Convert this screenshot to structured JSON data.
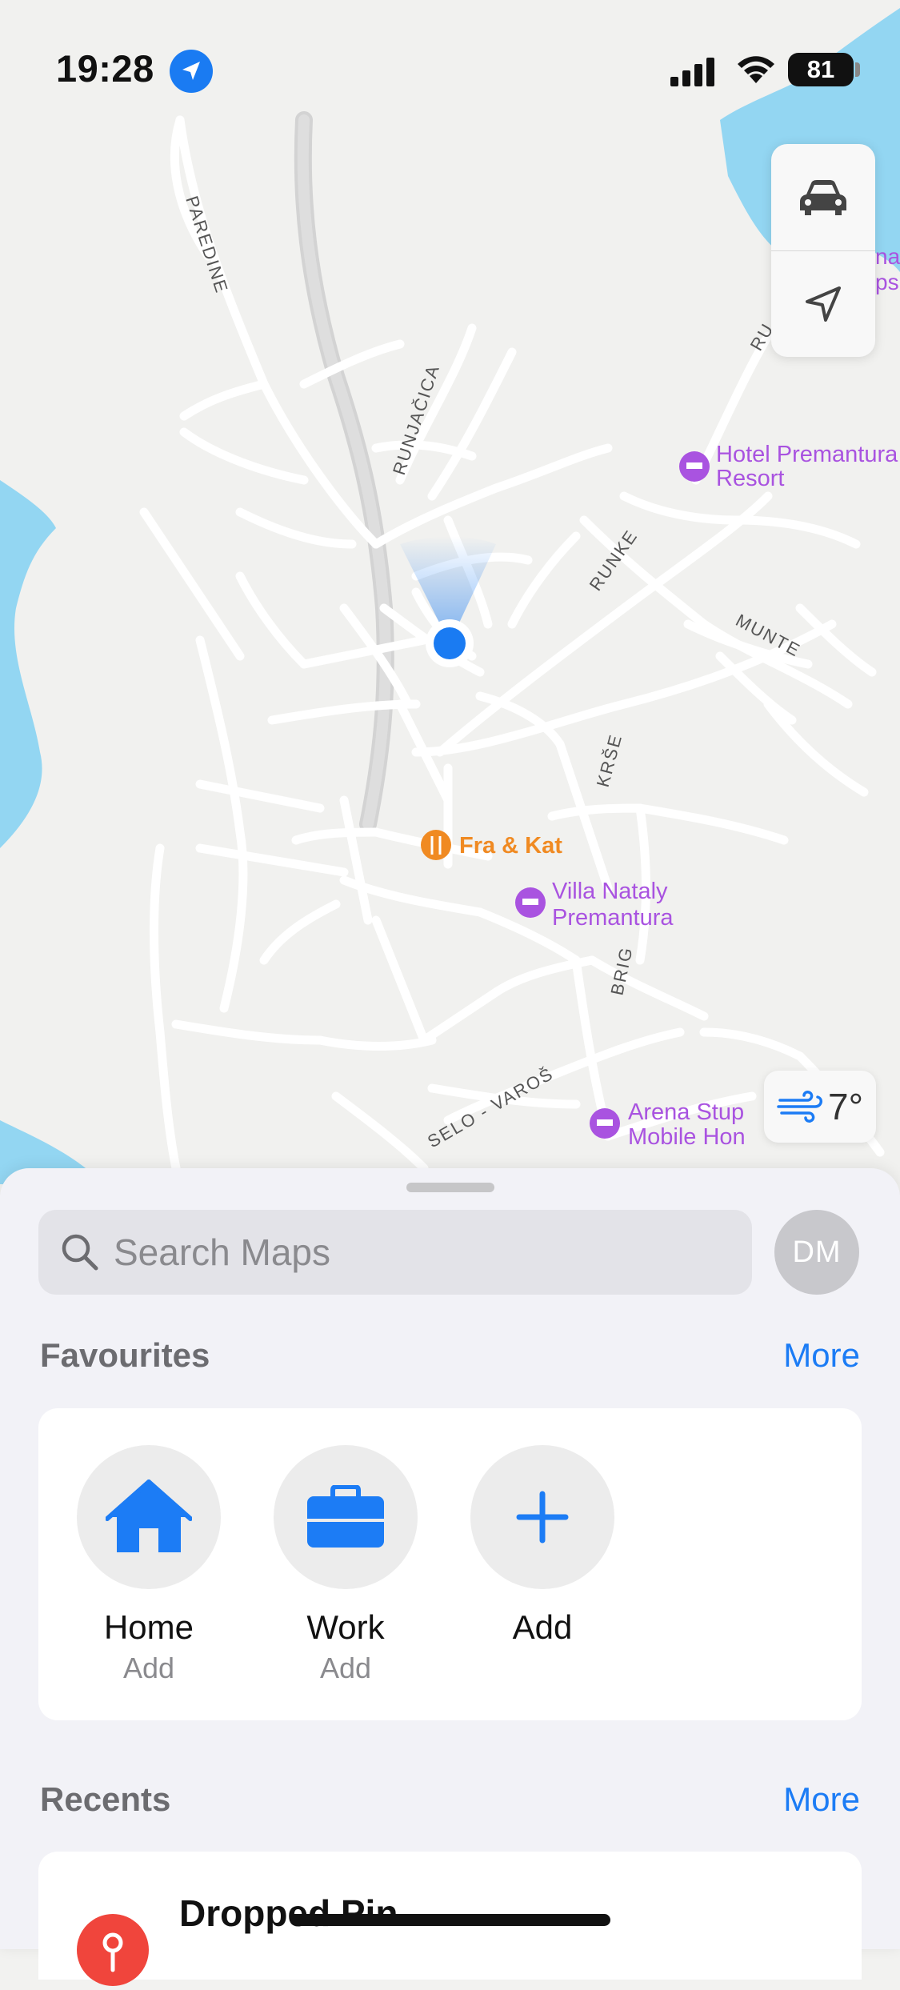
{
  "status_bar": {
    "time": "19:28",
    "battery": "81",
    "location_icon": "location-arrow-icon",
    "signal_icon": "cellular-signal-icon",
    "wifi_icon": "wifi-icon"
  },
  "map": {
    "street_labels": [
      "PAREDINE",
      "RUNJAČICA",
      "RUNKE",
      "MUNTE",
      "KRŠE",
      "BRIG",
      "SELO - VAROŠ"
    ],
    "pois": [
      {
        "name": "Hotel Premantura Resort",
        "lines": [
          "Hotel Premantura",
          "Resort"
        ],
        "type": "hotel",
        "color": "#a953e0"
      },
      {
        "name": "Fra & Kat",
        "lines": [
          "Fra & Kat"
        ],
        "type": "restaurant",
        "color": "#f08a22"
      },
      {
        "name": "Villa Nataly Premantura",
        "lines": [
          "Villa Nataly",
          "Premantura"
        ],
        "type": "hotel",
        "color": "#a953e0"
      },
      {
        "name": "Arena Stupice Mobile Homes",
        "lines": [
          "Arena Stup",
          "Mobile Hon"
        ],
        "type": "hotel",
        "color": "#a953e0"
      }
    ],
    "edge_label_fragments": [
      "na",
      "ps",
      "RU"
    ],
    "water_color": "#93d6f2",
    "road_color": "#ffffff",
    "user_location_color": "#1a7bf2"
  },
  "map_controls": {
    "drive_icon": "car-icon",
    "location_icon": "navigation-arrow-icon",
    "weather_icon": "wind-icon",
    "temperature": "7°"
  },
  "sheet": {
    "search_placeholder": "Search Maps",
    "avatar_initials": "DM",
    "favourites": {
      "title": "Favourites",
      "more": "More",
      "items": [
        {
          "label": "Home",
          "sub": "Add",
          "icon": "house-icon"
        },
        {
          "label": "Work",
          "sub": "Add",
          "icon": "briefcase-icon"
        },
        {
          "label": "Add",
          "sub": "",
          "icon": "plus-icon"
        }
      ]
    },
    "recents": {
      "title": "Recents",
      "more": "More",
      "items": [
        {
          "title": "Dropped Pin",
          "icon": "pin-icon"
        }
      ]
    }
  },
  "colors": {
    "accent": "#1c7cf5",
    "pin": "#f0453c"
  }
}
